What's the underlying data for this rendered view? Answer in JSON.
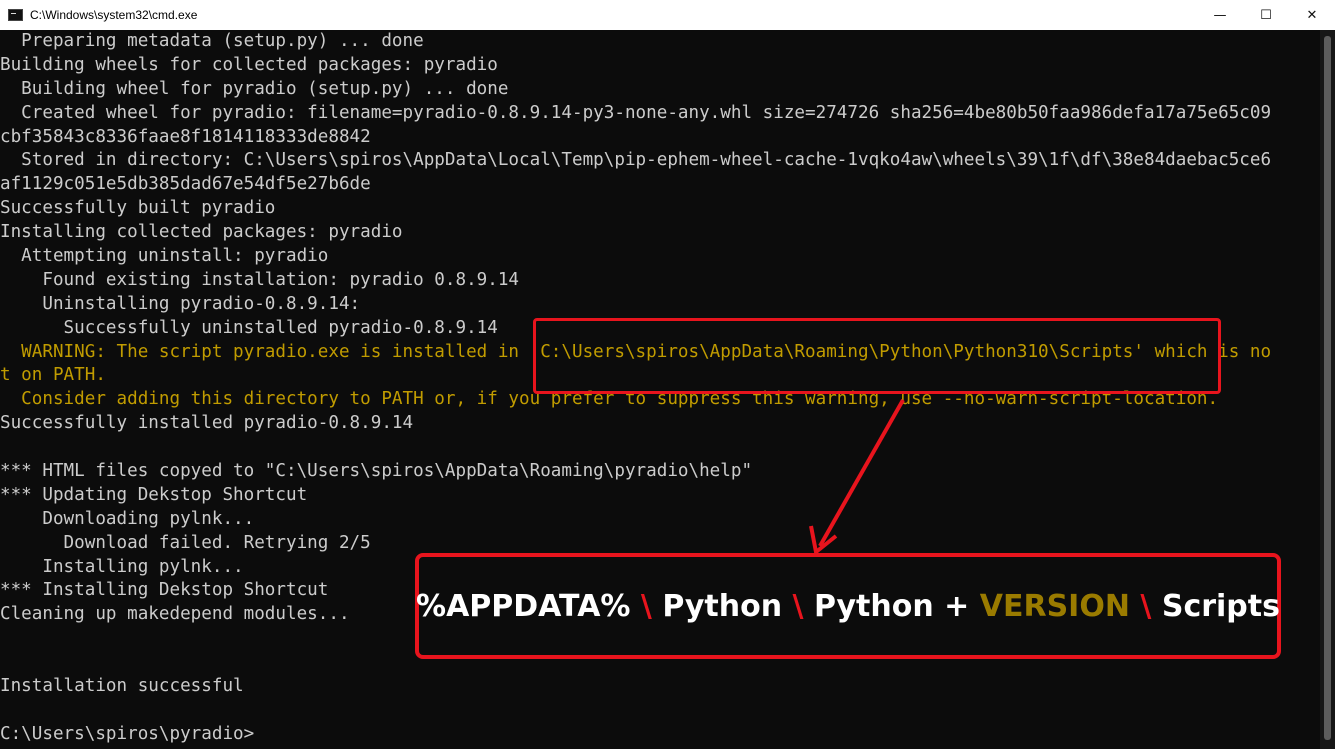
{
  "window": {
    "title": "C:\\Windows\\system32\\cmd.exe",
    "controls": {
      "minimize": "—",
      "maximize": "☐",
      "close": "✕"
    }
  },
  "terminal": {
    "lines": [
      {
        "text": "  Preparing metadata (setup.py) ... done",
        "kind": "normal"
      },
      {
        "text": "Building wheels for collected packages: pyradio",
        "kind": "normal"
      },
      {
        "text": "  Building wheel for pyradio (setup.py) ... done",
        "kind": "normal"
      },
      {
        "text": "  Created wheel for pyradio: filename=pyradio-0.8.9.14-py3-none-any.whl size=274726 sha256=4be80b50faa986defa17a75e65c09",
        "kind": "normal"
      },
      {
        "text": "cbf35843c8336faae8f1814118333de8842",
        "kind": "normal"
      },
      {
        "text": "  Stored in directory: C:\\Users\\spiros\\AppData\\Local\\Temp\\pip-ephem-wheel-cache-1vqko4aw\\wheels\\39\\1f\\df\\38e84daebac5ce6",
        "kind": "normal"
      },
      {
        "text": "af1129c051e5db385dad67e54df5e27b6de",
        "kind": "normal"
      },
      {
        "text": "Successfully built pyradio",
        "kind": "normal"
      },
      {
        "text": "Installing collected packages: pyradio",
        "kind": "normal"
      },
      {
        "text": "  Attempting uninstall: pyradio",
        "kind": "normal"
      },
      {
        "text": "    Found existing installation: pyradio 0.8.9.14",
        "kind": "normal"
      },
      {
        "text": "    Uninstalling pyradio-0.8.9.14:",
        "kind": "normal"
      },
      {
        "text": "      Successfully uninstalled pyradio-0.8.9.14",
        "kind": "normal"
      },
      {
        "text": "  WARNING: The script pyradio.exe is installed in 'C:\\Users\\spiros\\AppData\\Roaming\\Python\\Python310\\Scripts' which is no",
        "kind": "warn"
      },
      {
        "text": "t on PATH.",
        "kind": "warn"
      },
      {
        "text": "  Consider adding this directory to PATH or, if you prefer to suppress this warning, use --no-warn-script-location.",
        "kind": "warn"
      },
      {
        "text": "Successfully installed pyradio-0.8.9.14",
        "kind": "normal"
      },
      {
        "text": "",
        "kind": "normal"
      },
      {
        "text": "*** HTML files copyed to \"C:\\Users\\spiros\\AppData\\Roaming\\pyradio\\help\"",
        "kind": "normal"
      },
      {
        "text": "*** Updating Dekstop Shortcut",
        "kind": "normal"
      },
      {
        "text": "    Downloading pylnk...",
        "kind": "normal"
      },
      {
        "text": "      Download failed. Retrying 2/5",
        "kind": "normal"
      },
      {
        "text": "    Installing pylnk...",
        "kind": "normal"
      },
      {
        "text": "*** Installing Dekstop Shortcut",
        "kind": "normal"
      },
      {
        "text": "Cleaning up makedepend modules...",
        "kind": "normal"
      },
      {
        "text": "",
        "kind": "normal"
      },
      {
        "text": "",
        "kind": "normal"
      },
      {
        "text": "Installation successful",
        "kind": "normal"
      },
      {
        "text": "",
        "kind": "normal"
      },
      {
        "text": "C:\\Users\\spiros\\pyradio>",
        "kind": "normal"
      }
    ]
  },
  "callout": {
    "part1": "%APPDATA% ",
    "sep1": "\\",
    "part2": " Python ",
    "sep2": "\\",
    "part3": " Python + ",
    "version": "VERSION",
    "part4": " ",
    "sep3": "\\",
    "part5": " Scripts"
  },
  "colors": {
    "background": "#0c0c0c",
    "text": "#cccccc",
    "warning": "#c19c00",
    "annotation_red": "#e8141d",
    "version_gold": "#9a7b00"
  }
}
